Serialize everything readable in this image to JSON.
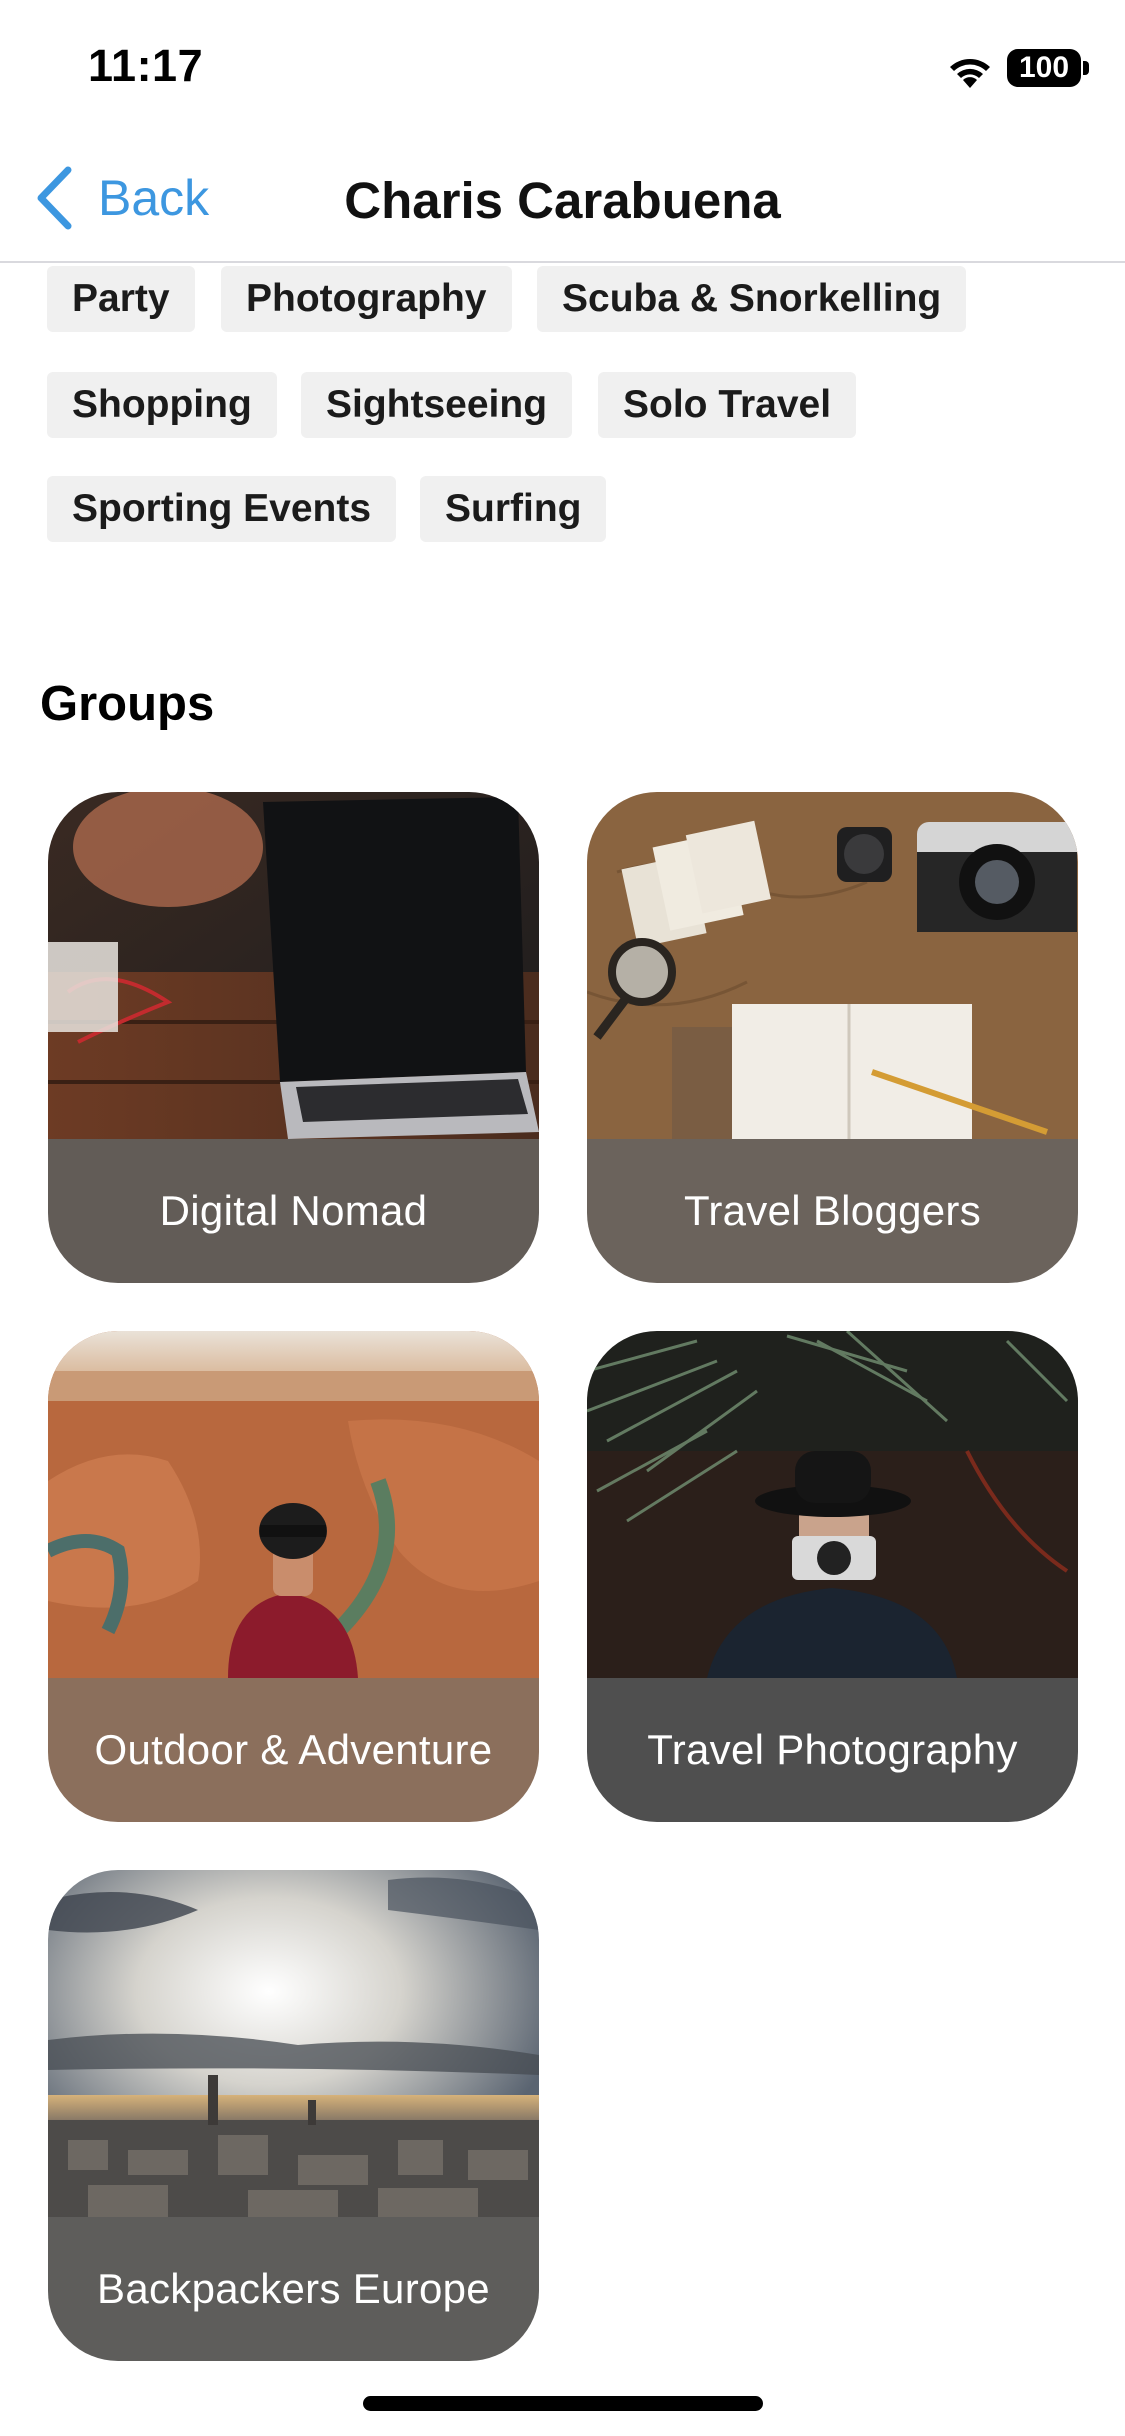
{
  "status_bar": {
    "time": "11:17",
    "battery": "100"
  },
  "nav": {
    "back_label": "Back",
    "title": "Charis Carabuena"
  },
  "tags": [
    "Party",
    "Photography",
    "Scuba & Snorkelling",
    "Shopping",
    "Sightseeing",
    "Solo Travel",
    "Sporting Events",
    "Surfing"
  ],
  "groups": {
    "title": "Groups",
    "items": [
      {
        "label": "Digital Nomad",
        "bar_color": "#625c57"
      },
      {
        "label": "Travel Bloggers",
        "bar_color": "#6b635c"
      },
      {
        "label": "Outdoor & Adventure",
        "bar_color": "#8b6f5c"
      },
      {
        "label": "Travel Photography",
        "bar_color": "#4f4f4f"
      },
      {
        "label": "Backpackers Europe",
        "bar_color": "#5e5d5b"
      }
    ]
  },
  "icons": {
    "back": "chevron-left-icon",
    "wifi": "wifi-icon",
    "battery": "battery-icon"
  }
}
